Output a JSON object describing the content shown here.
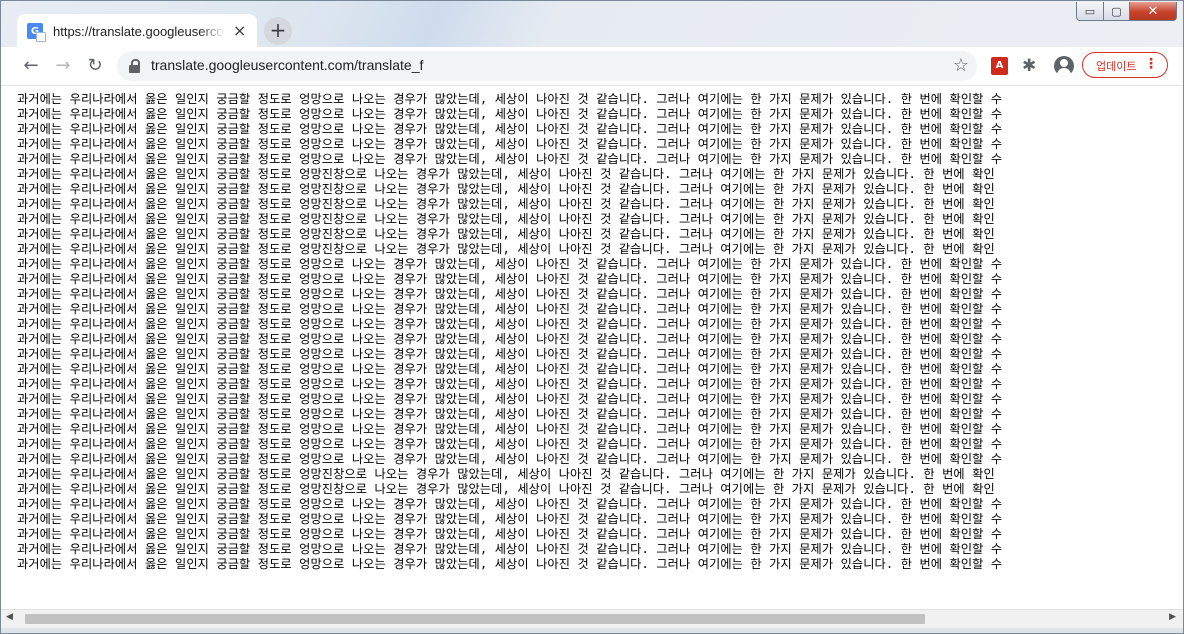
{
  "tab": {
    "title": "https://translate.googleusercontent.com/translate_f",
    "close_glyph": "×",
    "favicon_letter": "G"
  },
  "newtab": {
    "glyph": "+"
  },
  "window_controls": {
    "minimize": "▭",
    "maximize": "▢",
    "close": "✕"
  },
  "toolbar": {
    "back_glyph": "←",
    "forward_glyph": "→",
    "reload_glyph": "↻",
    "url": "translate.googleusercontent.com/translate_f",
    "bookmark_glyph": "☆",
    "extension_puzzle_glyph": "✱",
    "pdf_glyph": "A",
    "update_label": "업데이트",
    "menu_glyph": "⋮"
  },
  "content": {
    "lines": [
      "과거에는 우리나라에서 옳은 일인지 궁금할 정도로 엉망으로 나오는 경우가 많았는데, 세상이 나아진 것 같습니다. 그러나 여기에는 한 가지 문제가 있습니다. 한 번에 확인할 수",
      "과거에는 우리나라에서 옳은 일인지 궁금할 정도로 엉망으로 나오는 경우가 많았는데, 세상이 나아진 것 같습니다. 그러나 여기에는 한 가지 문제가 있습니다. 한 번에 확인할 수",
      "과거에는 우리나라에서 옳은 일인지 궁금할 정도로 엉망으로 나오는 경우가 많았는데, 세상이 나아진 것 같습니다. 그러나 여기에는 한 가지 문제가 있습니다. 한 번에 확인할 수",
      "과거에는 우리나라에서 옳은 일인지 궁금할 정도로 엉망으로 나오는 경우가 많았는데, 세상이 나아진 것 같습니다. 그러나 여기에는 한 가지 문제가 있습니다. 한 번에 확인할 수",
      "과거에는 우리나라에서 옳은 일인지 궁금할 정도로 엉망으로 나오는 경우가 많았는데, 세상이 나아진 것 같습니다. 그러나 여기에는 한 가지 문제가 있습니다. 한 번에 확인할 수",
      "과거에는 우리나라에서 옳은 일인지 궁금할 정도로 엉망진창으로 나오는 경우가 많았는데, 세상이 나아진 것 같습니다. 그러나 여기에는 한 가지 문제가 있습니다. 한 번에 확인",
      "과거에는 우리나라에서 옳은 일인지 궁금할 정도로 엉망진창으로 나오는 경우가 많았는데, 세상이 나아진 것 같습니다. 그러나 여기에는 한 가지 문제가 있습니다. 한 번에 확인",
      "과거에는 우리나라에서 옳은 일인지 궁금할 정도로 엉망진창으로 나오는 경우가 많았는데, 세상이 나아진 것 같습니다. 그러나 여기에는 한 가지 문제가 있습니다. 한 번에 확인",
      "과거에는 우리나라에서 옳은 일인지 궁금할 정도로 엉망진창으로 나오는 경우가 많았는데, 세상이 나아진 것 같습니다. 그러나 여기에는 한 가지 문제가 있습니다. 한 번에 확인",
      "과거에는 우리나라에서 옳은 일인지 궁금할 정도로 엉망진창으로 나오는 경우가 많았는데, 세상이 나아진 것 같습니다. 그러나 여기에는 한 가지 문제가 있습니다. 한 번에 확인",
      "과거에는 우리나라에서 옳은 일인지 궁금할 정도로 엉망진창으로 나오는 경우가 많았는데, 세상이 나아진 것 같습니다. 그러나 여기에는 한 가지 문제가 있습니다. 한 번에 확인",
      "과거에는 우리나라에서 옳은 일인지 궁금할 정도로 엉망으로 나오는 경우가 많았는데, 세상이 나아진 것 같습니다. 그러나 여기에는 한 가지 문제가 있습니다. 한 번에 확인할 수",
      "과거에는 우리나라에서 옳은 일인지 궁금할 정도로 엉망으로 나오는 경우가 많았는데, 세상이 나아진 것 같습니다. 그러나 여기에는 한 가지 문제가 있습니다. 한 번에 확인할 수",
      "과거에는 우리나라에서 옳은 일인지 궁금할 정도로 엉망으로 나오는 경우가 많았는데, 세상이 나아진 것 같습니다. 그러나 여기에는 한 가지 문제가 있습니다. 한 번에 확인할 수",
      "과거에는 우리나라에서 옳은 일인지 궁금할 정도로 엉망으로 나오는 경우가 많았는데, 세상이 나아진 것 같습니다. 그러나 여기에는 한 가지 문제가 있습니다. 한 번에 확인할 수",
      "과거에는 우리나라에서 옳은 일인지 궁금할 정도로 엉망으로 나오는 경우가 많았는데, 세상이 나아진 것 같습니다. 그러나 여기에는 한 가지 문제가 있습니다. 한 번에 확인할 수",
      "과거에는 우리나라에서 옳은 일인지 궁금할 정도로 엉망으로 나오는 경우가 많았는데, 세상이 나아진 것 같습니다. 그러나 여기에는 한 가지 문제가 있습니다. 한 번에 확인할 수",
      "과거에는 우리나라에서 옳은 일인지 궁금할 정도로 엉망으로 나오는 경우가 많았는데, 세상이 나아진 것 같습니다. 그러나 여기에는 한 가지 문제가 있습니다. 한 번에 확인할 수",
      "과거에는 우리나라에서 옳은 일인지 궁금할 정도로 엉망으로 나오는 경우가 많았는데, 세상이 나아진 것 같습니다. 그러나 여기에는 한 가지 문제가 있습니다. 한 번에 확인할 수",
      "과거에는 우리나라에서 옳은 일인지 궁금할 정도로 엉망으로 나오는 경우가 많았는데, 세상이 나아진 것 같습니다. 그러나 여기에는 한 가지 문제가 있습니다. 한 번에 확인할 수",
      "과거에는 우리나라에서 옳은 일인지 궁금할 정도로 엉망으로 나오는 경우가 많았는데, 세상이 나아진 것 같습니다. 그러나 여기에는 한 가지 문제가 있습니다. 한 번에 확인할 수",
      "과거에는 우리나라에서 옳은 일인지 궁금할 정도로 엉망으로 나오는 경우가 많았는데, 세상이 나아진 것 같습니다. 그러나 여기에는 한 가지 문제가 있습니다. 한 번에 확인할 수",
      "과거에는 우리나라에서 옳은 일인지 궁금할 정도로 엉망으로 나오는 경우가 많았는데, 세상이 나아진 것 같습니다. 그러나 여기에는 한 가지 문제가 있습니다. 한 번에 확인할 수",
      "과거에는 우리나라에서 옳은 일인지 궁금할 정도로 엉망으로 나오는 경우가 많았는데, 세상이 나아진 것 같습니다. 그러나 여기에는 한 가지 문제가 있습니다. 한 번에 확인할 수",
      "과거에는 우리나라에서 옳은 일인지 궁금할 정도로 엉망으로 나오는 경우가 많았는데, 세상이 나아진 것 같습니다. 그러나 여기에는 한 가지 문제가 있습니다. 한 번에 확인할 수",
      "과거에는 우리나라에서 옳은 일인지 궁금할 정도로 엉망진창으로 나오는 경우가 많았는데, 세상이 나아진 것 같습니다. 그러나 여기에는 한 가지 문제가 있습니다. 한 번에 확인",
      "과거에는 우리나라에서 옳은 일인지 궁금할 정도로 엉망진창으로 나오는 경우가 많았는데, 세상이 나아진 것 같습니다. 그러나 여기에는 한 가지 문제가 있습니다. 한 번에 확인",
      "과거에는 우리나라에서 옳은 일인지 궁금할 정도로 엉망으로 나오는 경우가 많았는데, 세상이 나아진 것 같습니다. 그러나 여기에는 한 가지 문제가 있습니다. 한 번에 확인할 수",
      "과거에는 우리나라에서 옳은 일인지 궁금할 정도로 엉망으로 나오는 경우가 많았는데, 세상이 나아진 것 같습니다. 그러나 여기에는 한 가지 문제가 있습니다. 한 번에 확인할 수",
      "과거에는 우리나라에서 옳은 일인지 궁금할 정도로 엉망으로 나오는 경우가 많았는데, 세상이 나아진 것 같습니다. 그러나 여기에는 한 가지 문제가 있습니다. 한 번에 확인할 수",
      "과거에는 우리나라에서 옳은 일인지 궁금할 정도로 엉망으로 나오는 경우가 많았는데, 세상이 나아진 것 같습니다. 그러나 여기에는 한 가지 문제가 있습니다. 한 번에 확인할 수",
      "과거에는 우리나라에서 옳은 일인지 궁금할 정도로 엉망으로 나오는 경우가 많았는데, 세상이 나아진 것 같습니다. 그러나 여기에는 한 가지 문제가 있습니다. 한 번에 확인할 수"
    ]
  },
  "scrollbar": {
    "left_glyph": "◀",
    "right_glyph": "▶"
  }
}
